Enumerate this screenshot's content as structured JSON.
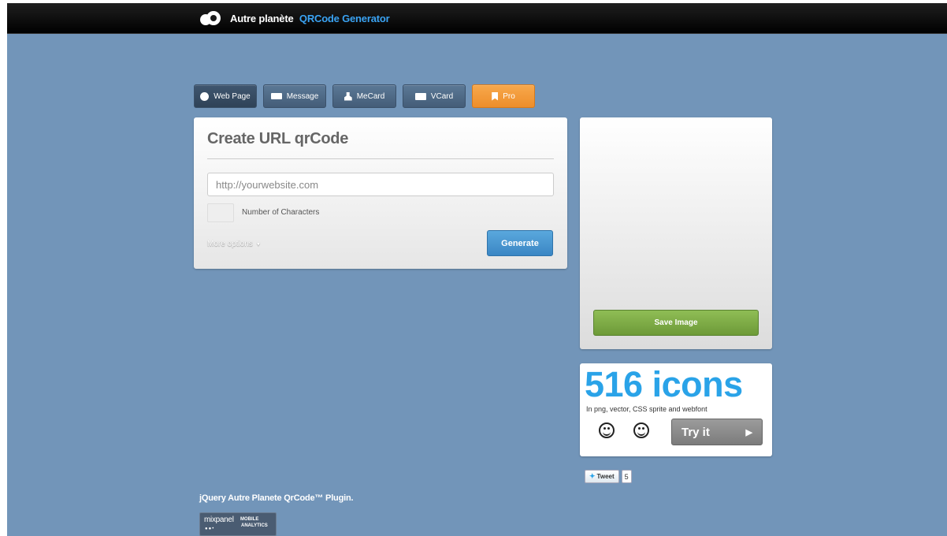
{
  "header": {
    "brand_prefix": "Autre planète",
    "brand_accent": "QRCode Generator"
  },
  "tabs": [
    {
      "label": "Web Page",
      "icon": "globe-icon"
    },
    {
      "label": "Message",
      "icon": "message-icon"
    },
    {
      "label": "MeCard",
      "icon": "user-icon"
    },
    {
      "label": "VCard",
      "icon": "vcard-icon"
    },
    {
      "label": "Pro",
      "icon": "bookmark-icon"
    }
  ],
  "form": {
    "title": "Create URL qrCode",
    "url_placeholder": "http://yourwebsite.com",
    "char_count_label": "Number of Characters",
    "more_options": "More options",
    "generate": "Generate"
  },
  "qr_panel": {
    "save_label": "Save Image"
  },
  "ad": {
    "title": "516 icons",
    "subtitle": "In png, vector, CSS sprite and webfont",
    "cta": "Try it"
  },
  "tweet": {
    "label": "Tweet",
    "count": "5"
  },
  "footer": {
    "plugin_title": "jQuery Autre Planete QrCode™ Plugin.",
    "mixpanel_name": "mixpanel",
    "mixpanel_mobile": "MOBILE",
    "mixpanel_analytics": "ANALYTICS"
  },
  "colors": {
    "background": "#7295b9",
    "accent": "#3aa3f3",
    "pro_tab": "#ee8e2a",
    "save_button": "#7aa943",
    "generate_button": "#4596cf"
  }
}
